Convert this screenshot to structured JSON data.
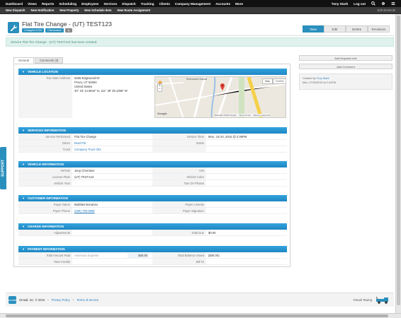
{
  "topnav": {
    "items": [
      "Dashboard",
      "Views",
      "Reports",
      "Scheduling",
      "Employees",
      "Services",
      "Dispatch",
      "Tracking",
      "Clients",
      "Company Management",
      "Accounts",
      "More"
    ],
    "user": "Tony Stark",
    "logout": "Log out"
  },
  "subnav": {
    "items": [
      "New Dispatch",
      "New Notification",
      "New Property",
      "New Schedule Item",
      "New Route Assignment"
    ],
    "edit": "Edit shortcuts"
  },
  "header": {
    "title": "Flat Tire Change - (UT) TEST123",
    "badges": [
      "Chargeto:COD",
      "Clientname:"
    ],
    "actions": [
      "View",
      "Edit",
      "Delete",
      "Revisions"
    ]
  },
  "alert": "Service Flat Tire Change - (UT) TEST123 has been created.",
  "tabs": [
    "General",
    "Comments (0)"
  ],
  "sidebar": {
    "buttons": [
      "Add Dispatch Info",
      "Add Comment"
    ],
    "created_by_label": "Created by",
    "created_by": "Tony Stark",
    "created_on": "Mon, 07/20/2015 at 2:41PM"
  },
  "support": "SUPPORT",
  "sections": {
    "vehicle_location": {
      "title": "VEHICLE LOCATION",
      "label": "Tow Start Address",
      "address": [
        "5255 Edgewood Dr",
        "Provo, UT 84604",
        "United States",
        "40° 18' 14.0844\" N, 111° 39' 29.1096\" W"
      ],
      "map": {
        "tab_map": "Map",
        "tab_sat": "Satellite",
        "attribution": "Map data ©2015 Google",
        "terms": "Terms of Use",
        "report": "Report a map error",
        "google": "Google",
        "poi": "Riverwoods Hospital"
      }
    },
    "services": {
      "title": "SERVICES INFORMATION",
      "rows": [
        {
          "l1": "Service Performed",
          "v1": "Flat Tire Change",
          "l2": "Service Time",
          "v2": "Mon, Jul 20, 2015 @ 2:36PM"
        },
        {
          "l1": "Driver",
          "v1": "Brad Pitt",
          "l2": "Notes",
          "v2": ""
        },
        {
          "l1": "Truck",
          "v1": "Company Truck 003",
          "l2": "",
          "v2": ""
        }
      ]
    },
    "vehicle": {
      "title": "VEHICLE INFORMATION",
      "rows": [
        {
          "l1": "Vehicle",
          "v1": "Jeep Cherokee",
          "l2": "VIN",
          "v2": ""
        },
        {
          "l1": "License Plate",
          "v1": "(UT) TEST123",
          "l2": "Vehicle Color",
          "v2": ""
        },
        {
          "l1": "Vehicle Year",
          "v1": "",
          "l2": "Tow On Photos",
          "v2": ""
        }
      ]
    },
    "customer": {
      "title": "CUSTOMER INFORMATION",
      "rows": [
        {
          "l1": "Payer Name",
          "v1": "Bubbles Bonanza",
          "l2": "Payer License",
          "v2": ""
        },
        {
          "l1": "Payer Phone",
          "v1": "(409) 799-9999",
          "l2": "Payer Signature",
          "v2": ""
        }
      ]
    },
    "charge": {
      "title": "CHARGE INFORMATION",
      "rows": [
        {
          "l1": "Adjustments",
          "v1": "",
          "l2": "Total Due",
          "v2": "$0.00"
        }
      ]
    },
    "payment": {
      "title": "PAYMENT INFORMATION",
      "rows": [
        {
          "l1": "Total Amount Paid",
          "v1": "American Express",
          "v1b": "$40.00",
          "l2": "Total Balance Owed",
          "v2": "($40.00)"
        },
        {
          "l1": "Total Credits",
          "v1": "",
          "v1b": "",
          "l2": "Bill To",
          "v2": ""
        }
      ]
    }
  },
  "footer": {
    "copyright": "Omadi, Inc. © 2015",
    "privacy": "Privacy Policy",
    "terms": "Terms of Service",
    "company": "Omadi Towing",
    "logo": "omadi"
  },
  "colors": {
    "accent": "#2a8fbd",
    "header_bar": "#111111",
    "section_blue": "#1e86c2"
  }
}
